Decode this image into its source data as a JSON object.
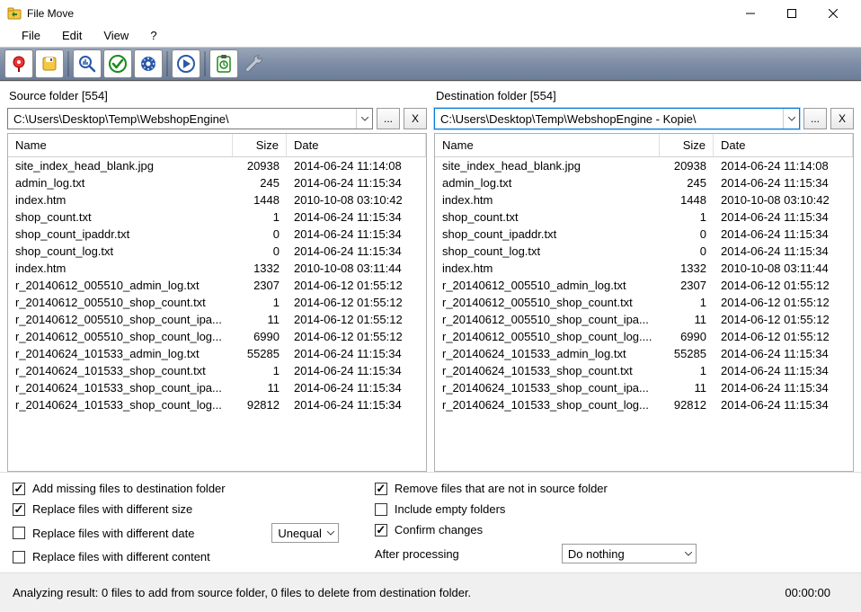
{
  "window": {
    "title": "File Move"
  },
  "menu": {
    "file": "File",
    "edit": "Edit",
    "view": "View",
    "help": "?"
  },
  "source": {
    "label": "Source folder [554]",
    "path": "C:\\Users\\Desktop\\Temp\\WebshopEngine\\",
    "browse": "...",
    "clear": "X",
    "headers": {
      "name": "Name",
      "size": "Size",
      "date": "Date"
    },
    "files": [
      {
        "name": "site_index_head_blank.jpg",
        "size": "20938",
        "date": "2014-06-24 11:14:08"
      },
      {
        "name": "admin_log.txt",
        "size": "245",
        "date": "2014-06-24 11:15:34"
      },
      {
        "name": "index.htm",
        "size": "1448",
        "date": "2010-10-08 03:10:42"
      },
      {
        "name": "shop_count.txt",
        "size": "1",
        "date": "2014-06-24 11:15:34"
      },
      {
        "name": "shop_count_ipaddr.txt",
        "size": "0",
        "date": "2014-06-24 11:15:34"
      },
      {
        "name": "shop_count_log.txt",
        "size": "0",
        "date": "2014-06-24 11:15:34"
      },
      {
        "name": "index.htm",
        "size": "1332",
        "date": "2010-10-08 03:11:44"
      },
      {
        "name": "r_20140612_005510_admin_log.txt",
        "size": "2307",
        "date": "2014-06-12 01:55:12"
      },
      {
        "name": "r_20140612_005510_shop_count.txt",
        "size": "1",
        "date": "2014-06-12 01:55:12"
      },
      {
        "name": "r_20140612_005510_shop_count_ipa...",
        "size": "11",
        "date": "2014-06-12 01:55:12"
      },
      {
        "name": "r_20140612_005510_shop_count_log...",
        "size": "6990",
        "date": "2014-06-12 01:55:12"
      },
      {
        "name": "r_20140624_101533_admin_log.txt",
        "size": "55285",
        "date": "2014-06-24 11:15:34"
      },
      {
        "name": "r_20140624_101533_shop_count.txt",
        "size": "1",
        "date": "2014-06-24 11:15:34"
      },
      {
        "name": "r_20140624_101533_shop_count_ipa...",
        "size": "11",
        "date": "2014-06-24 11:15:34"
      },
      {
        "name": "r_20140624_101533_shop_count_log...",
        "size": "92812",
        "date": "2014-06-24 11:15:34"
      }
    ]
  },
  "dest": {
    "label": "Destination folder [554]",
    "path": "C:\\Users\\Desktop\\Temp\\WebshopEngine - Kopie\\",
    "browse": "...",
    "clear": "X",
    "headers": {
      "name": "Name",
      "size": "Size",
      "date": "Date"
    },
    "files": [
      {
        "name": "site_index_head_blank.jpg",
        "size": "20938",
        "date": "2014-06-24 11:14:08"
      },
      {
        "name": "admin_log.txt",
        "size": "245",
        "date": "2014-06-24 11:15:34"
      },
      {
        "name": "index.htm",
        "size": "1448",
        "date": "2010-10-08 03:10:42"
      },
      {
        "name": "shop_count.txt",
        "size": "1",
        "date": "2014-06-24 11:15:34"
      },
      {
        "name": "shop_count_ipaddr.txt",
        "size": "0",
        "date": "2014-06-24 11:15:34"
      },
      {
        "name": "shop_count_log.txt",
        "size": "0",
        "date": "2014-06-24 11:15:34"
      },
      {
        "name": "index.htm",
        "size": "1332",
        "date": "2010-10-08 03:11:44"
      },
      {
        "name": "r_20140612_005510_admin_log.txt",
        "size": "2307",
        "date": "2014-06-12 01:55:12"
      },
      {
        "name": "r_20140612_005510_shop_count.txt",
        "size": "1",
        "date": "2014-06-12 01:55:12"
      },
      {
        "name": "r_20140612_005510_shop_count_ipa...",
        "size": "11",
        "date": "2014-06-12 01:55:12"
      },
      {
        "name": "r_20140612_005510_shop_count_log....",
        "size": "6990",
        "date": "2014-06-12 01:55:12"
      },
      {
        "name": "r_20140624_101533_admin_log.txt",
        "size": "55285",
        "date": "2014-06-24 11:15:34"
      },
      {
        "name": "r_20140624_101533_shop_count.txt",
        "size": "1",
        "date": "2014-06-24 11:15:34"
      },
      {
        "name": "r_20140624_101533_shop_count_ipa...",
        "size": "11",
        "date": "2014-06-24 11:15:34"
      },
      {
        "name": "r_20140624_101533_shop_count_log...",
        "size": "92812",
        "date": "2014-06-24 11:15:34"
      }
    ]
  },
  "options": {
    "add_missing": "Add missing files to destination folder",
    "replace_size": "Replace files with different size",
    "replace_date": "Replace files with different date",
    "replace_content": "Replace files with different content",
    "date_mode": "Unequal",
    "remove_not_in_source": "Remove files that are not in source folder",
    "include_empty": "Include empty folders",
    "confirm": "Confirm changes",
    "after_processing_label": "After processing",
    "after_processing_value": "Do nothing"
  },
  "status": {
    "text": "Analyzing result: 0 files to add from source folder, 0 files to delete from destination folder.",
    "time": "00:00:00"
  }
}
